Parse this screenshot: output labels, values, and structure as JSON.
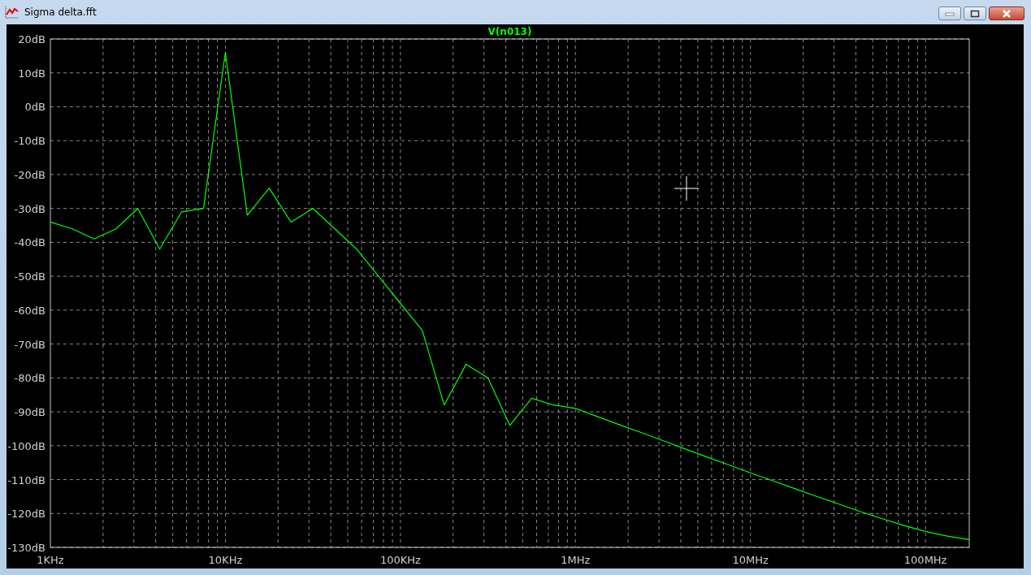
{
  "window": {
    "title": "Sigma delta.fft"
  },
  "plot": {
    "chart_data": {
      "type": "line",
      "categories": [
        "1KHz",
        null,
        null,
        null,
        null,
        null,
        null,
        null,
        "10KHz",
        null,
        null,
        null,
        null,
        null,
        null,
        null,
        "100KHz",
        null,
        null,
        null,
        null,
        null,
        null,
        null,
        "1MHz",
        null,
        null,
        null,
        null,
        null,
        null,
        null,
        "10MHz",
        null,
        null,
        null,
        null,
        null,
        null,
        null,
        "100MHz",
        null,
        null
      ],
      "series": [
        {
          "name": "V(n013)",
          "color": "#00ff00",
          "values": [
            -34,
            -36,
            -39,
            -36,
            -30,
            -42,
            -31,
            -30,
            16,
            -32,
            -24,
            -34,
            -30,
            -36,
            -42,
            -50,
            -58,
            -66,
            -88,
            -76,
            -80,
            -94,
            -86,
            -88,
            -89,
            -91.4,
            -93.8,
            -96.1,
            -98.5,
            -100.9,
            -103.3,
            -105.6,
            -108,
            -110.3,
            -112.6,
            -114.9,
            -117.1,
            -119.4,
            -121.5,
            -123.5,
            -125.3,
            -126.7,
            -127.7
          ]
        }
      ],
      "grid": true,
      "ylim": [
        -130,
        20
      ],
      "yticks": [
        {
          "value": 20,
          "label": "20dB"
        },
        {
          "value": 10,
          "label": "10dB"
        },
        {
          "value": 0,
          "label": "0dB"
        },
        {
          "value": -10,
          "label": "-10dB"
        },
        {
          "value": -20,
          "label": "-20dB"
        },
        {
          "value": -30,
          "label": "-30dB"
        },
        {
          "value": -40,
          "label": "-40dB"
        },
        {
          "value": -50,
          "label": "-50dB"
        },
        {
          "value": -60,
          "label": "-60dB"
        },
        {
          "value": -70,
          "label": "-70dB"
        },
        {
          "value": -80,
          "label": "-80dB"
        },
        {
          "value": -90,
          "label": "-90dB"
        },
        {
          "value": -100,
          "label": "-100dB"
        },
        {
          "value": -110,
          "label": "-110dB"
        },
        {
          "value": -120,
          "label": "-120dB"
        },
        {
          "value": -130,
          "label": "-130dB"
        }
      ]
    }
  }
}
